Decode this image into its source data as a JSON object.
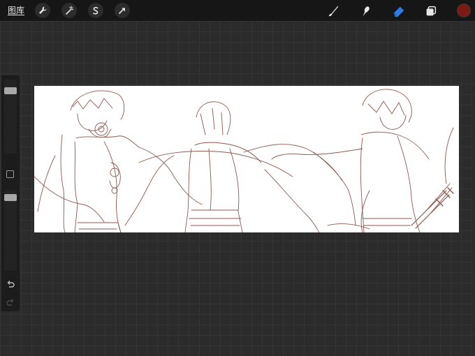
{
  "topbar": {
    "gallery_label": "图库",
    "left_tools": [
      {
        "name": "wrench-icon",
        "label": "actions"
      },
      {
        "name": "magic-wand-icon",
        "label": "adjustments"
      },
      {
        "name": "selection-icon",
        "label": "selection"
      },
      {
        "name": "transform-arrow-icon",
        "label": "transform"
      }
    ],
    "right_tools": [
      {
        "name": "brush-icon"
      },
      {
        "name": "smudge-icon"
      },
      {
        "name": "eraser-icon",
        "active": true
      },
      {
        "name": "layers-icon"
      }
    ],
    "current_color": "#7b1a14"
  },
  "sidebar": {
    "size_slider_icon": "size-slider",
    "opacity_slider_icon": "opacity-slider",
    "modify_button_icon": "square-icon",
    "undo_icon": "undo-icon",
    "redo_icon": "redo-icon"
  },
  "colors": {
    "accent": "#2f7be0",
    "sketch_line": "#7a3a30",
    "background": "#2b2b2b"
  }
}
